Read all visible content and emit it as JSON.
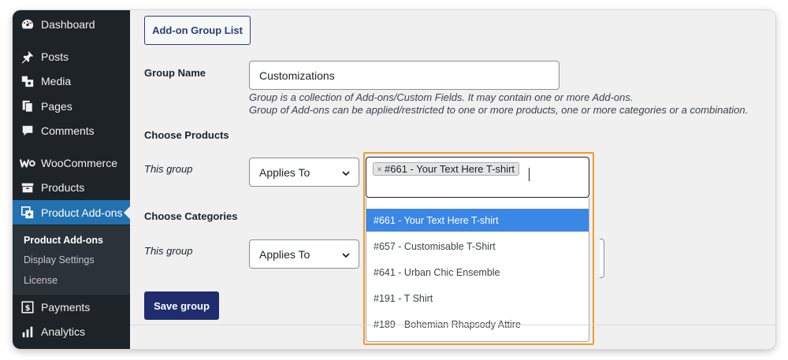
{
  "sidebar": {
    "items": [
      {
        "label": "Dashboard",
        "icon": "dashboard-icon"
      },
      {
        "label": "Posts",
        "icon": "pin-icon"
      },
      {
        "label": "Media",
        "icon": "media-icon"
      },
      {
        "label": "Pages",
        "icon": "pages-icon"
      },
      {
        "label": "Comments",
        "icon": "comments-icon"
      },
      {
        "label": "WooCommerce",
        "icon": "woocommerce-icon"
      },
      {
        "label": "Products",
        "icon": "products-icon"
      },
      {
        "label": "Product Add-ons",
        "icon": "product-addons-icon"
      },
      {
        "label": "Payments",
        "icon": "payments-icon"
      },
      {
        "label": "Analytics",
        "icon": "analytics-icon"
      }
    ],
    "submenu": [
      "Product Add-ons",
      "Display Settings",
      "License"
    ]
  },
  "main": {
    "group_list_button": "Add-on Group List",
    "group_name_label": "Group Name",
    "group_name_value": "Customizations",
    "group_desc_line1": "Group is a collection of Add-ons/Custom Fields. It may contain one or more Add-ons.",
    "group_desc_line2": "Group of Add-ons can be applied/restricted to one or more products, one or more categories or a combination.",
    "choose_products_label": "Choose Products",
    "this_group_label": "This group",
    "products_select_value": "Applies To",
    "selected_chip": "#661 - Your Text Here T-shirt",
    "choose_categories_label": "Choose Categories",
    "this_group_label_2": "This group",
    "categories_select_value": "Applies To",
    "save_button": "Save group"
  },
  "dropdown": {
    "options": [
      "#661 - Your Text Here T-shirt",
      "#657 - Customisable T-Shirt",
      "#641 - Urban Chic Ensemble",
      "#191 - T Shirt",
      "#189 - Bohemian Rhapsody Attire"
    ],
    "highlighted_index": 0
  },
  "colors": {
    "sidebar_bg": "#1d2327",
    "active_accent": "#2271b1",
    "primary_button": "#1f2d6e",
    "highlight_border": "#f39c2b",
    "option_highlight": "#3b87e6"
  }
}
